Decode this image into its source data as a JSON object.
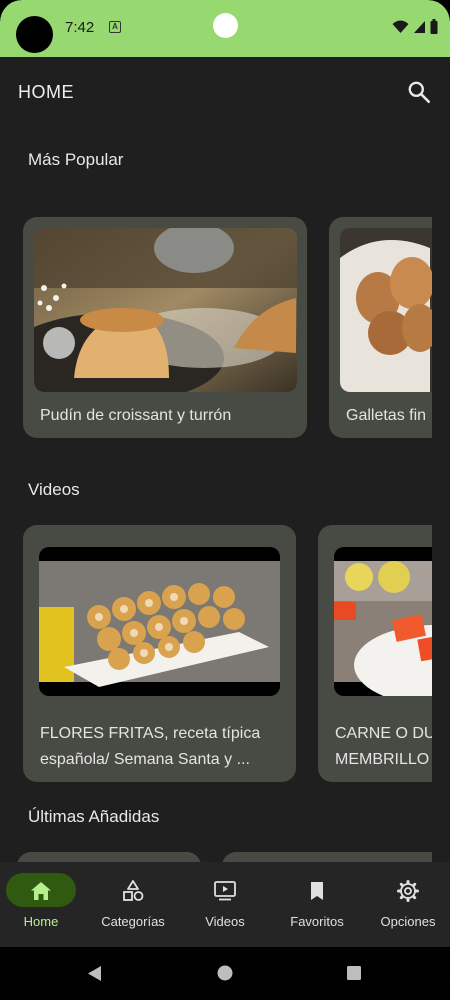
{
  "status_bar": {
    "time": "7:42",
    "notification_icon": "A"
  },
  "app_bar": {
    "title": "HOME",
    "search_icon": "search-icon"
  },
  "sections": {
    "popular": {
      "title": "Más Popular",
      "cards": [
        {
          "title": "Pudín de croissant y turrón"
        },
        {
          "title": "Galletas fin"
        }
      ]
    },
    "videos": {
      "title": "Videos",
      "cards": [
        {
          "title_line1": "FLORES FRITAS, receta típica",
          "title_line2": "española/ Semana Santa y ..."
        },
        {
          "title_line1": "CARNE O DU",
          "title_line2": "MEMBRILLO"
        }
      ]
    },
    "latest": {
      "title": "Últimas Añadidas"
    }
  },
  "bottom_nav": {
    "items": [
      {
        "label": "Home",
        "icon": "home-icon"
      },
      {
        "label": "Categorías",
        "icon": "categories-icon"
      },
      {
        "label": "Videos",
        "icon": "video-icon"
      },
      {
        "label": "Favoritos",
        "icon": "bookmark-icon"
      },
      {
        "label": "Opciones",
        "icon": "gear-icon"
      }
    ]
  },
  "colors": {
    "status_bar": "#97d871",
    "background": "#1f1f1f",
    "card": "#484a44",
    "nav_active_pill": "#2f5a10",
    "nav_active_label": "#b6f08e"
  }
}
